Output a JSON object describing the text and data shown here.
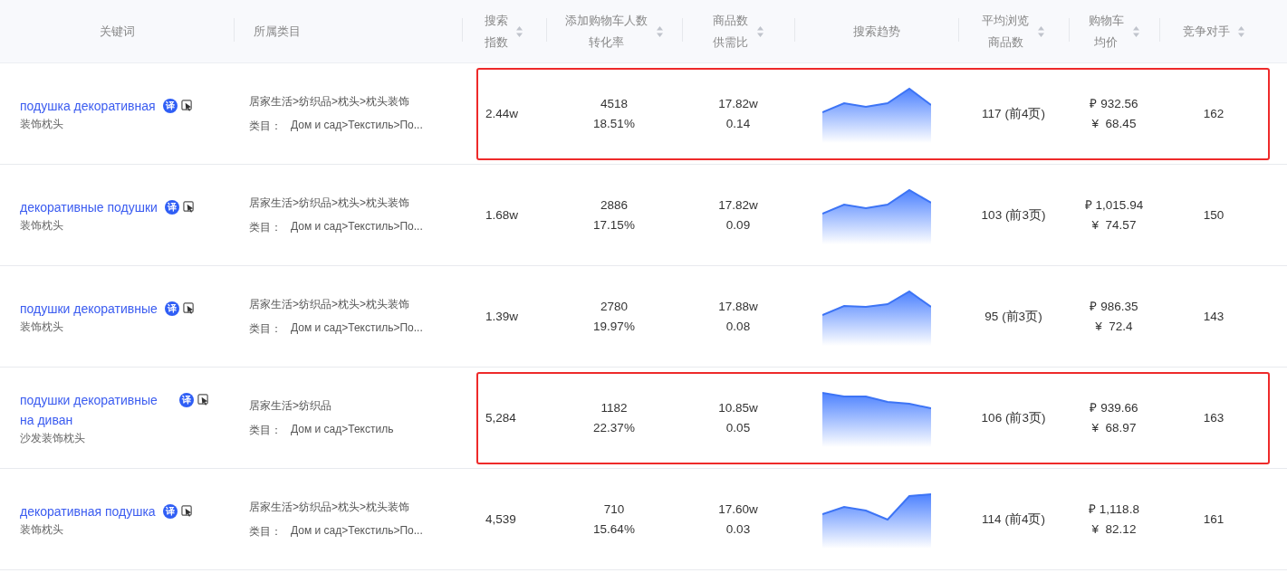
{
  "columns": [
    {
      "label": "关键词",
      "sortable": false
    },
    {
      "label": "所属类目",
      "sortable": false
    },
    {
      "label": "搜索指数",
      "sortable": true
    },
    {
      "label": "添加购物车人数转化率",
      "sortable": true
    },
    {
      "label": "商品数供需比",
      "sortable": true
    },
    {
      "label": "搜索趋势",
      "sortable": false
    },
    {
      "label": "平均浏览商品数",
      "sortable": true
    },
    {
      "label": "购物车均价",
      "sortable": true
    },
    {
      "label": "竞争对手",
      "sortable": true
    }
  ],
  "rows": [
    {
      "keyword": "подушка декоративная",
      "translate_badge": "译",
      "keyword_cn": "装饰枕头",
      "category_cn": "居家生活>纺织品>枕头>枕头装饰",
      "category_label": "类目：",
      "category_ru": "Дом и сад>Текстиль>По...",
      "search_index": "2.44w",
      "add_cart": "4518",
      "conversion": "18.51%",
      "goods": "17.82w",
      "supply_ratio": "0.14",
      "avg_browse": "117 (前4页)",
      "price_rub": "₽ 932.56",
      "price_cny": "¥  68.45",
      "competitors": "162",
      "highlighted": true
    },
    {
      "keyword": "декоративные подушки",
      "translate_badge": "译",
      "keyword_cn": "装饰枕头",
      "category_cn": "居家生活>纺织品>枕头>枕头装饰",
      "category_label": "类目：",
      "category_ru": "Дом и сад>Текстиль>По...",
      "search_index": "1.68w",
      "add_cart": "2886",
      "conversion": "17.15%",
      "goods": "17.82w",
      "supply_ratio": "0.09",
      "avg_browse": "103 (前3页)",
      "price_rub": "₽ 1,015.94",
      "price_cny": "¥  74.57",
      "competitors": "150",
      "highlighted": false
    },
    {
      "keyword": "подушки декоративные",
      "translate_badge": "译",
      "keyword_cn": "装饰枕头",
      "category_cn": "居家生活>纺织品>枕头>枕头装饰",
      "category_label": "类目：",
      "category_ru": "Дом и сад>Текстиль>По...",
      "search_index": "1.39w",
      "add_cart": "2780",
      "conversion": "19.97%",
      "goods": "17.88w",
      "supply_ratio": "0.08",
      "avg_browse": "95 (前3页)",
      "price_rub": "₽ 986.35",
      "price_cny": "¥  72.4",
      "competitors": "143",
      "highlighted": false
    },
    {
      "keyword": "подушки декоративные на диван",
      "translate_badge": "译",
      "keyword_cn": "沙发装饰枕头",
      "category_cn": "居家生活>纺织品",
      "category_label": "类目：",
      "category_ru": "Дом и сад>Текстиль",
      "search_index": "5,284",
      "add_cart": "1182",
      "conversion": "22.37%",
      "goods": "10.85w",
      "supply_ratio": "0.05",
      "avg_browse": "106 (前3页)",
      "price_rub": "₽ 939.66",
      "price_cny": "¥  68.97",
      "competitors": "163",
      "highlighted": true
    },
    {
      "keyword": "декоративная подушка",
      "translate_badge": "译",
      "keyword_cn": "装饰枕头",
      "category_cn": "居家生活>纺织品>枕头>枕头装饰",
      "category_label": "类目：",
      "category_ru": "Дом и сад>Текстиль>По...",
      "search_index": "4,539",
      "add_cart": "710",
      "conversion": "15.64%",
      "goods": "17.60w",
      "supply_ratio": "0.03",
      "avg_browse": "114 (前4页)",
      "price_rub": "₽ 1,118.8",
      "price_cny": "¥  82.12",
      "competitors": "161",
      "highlighted": false
    }
  ]
}
